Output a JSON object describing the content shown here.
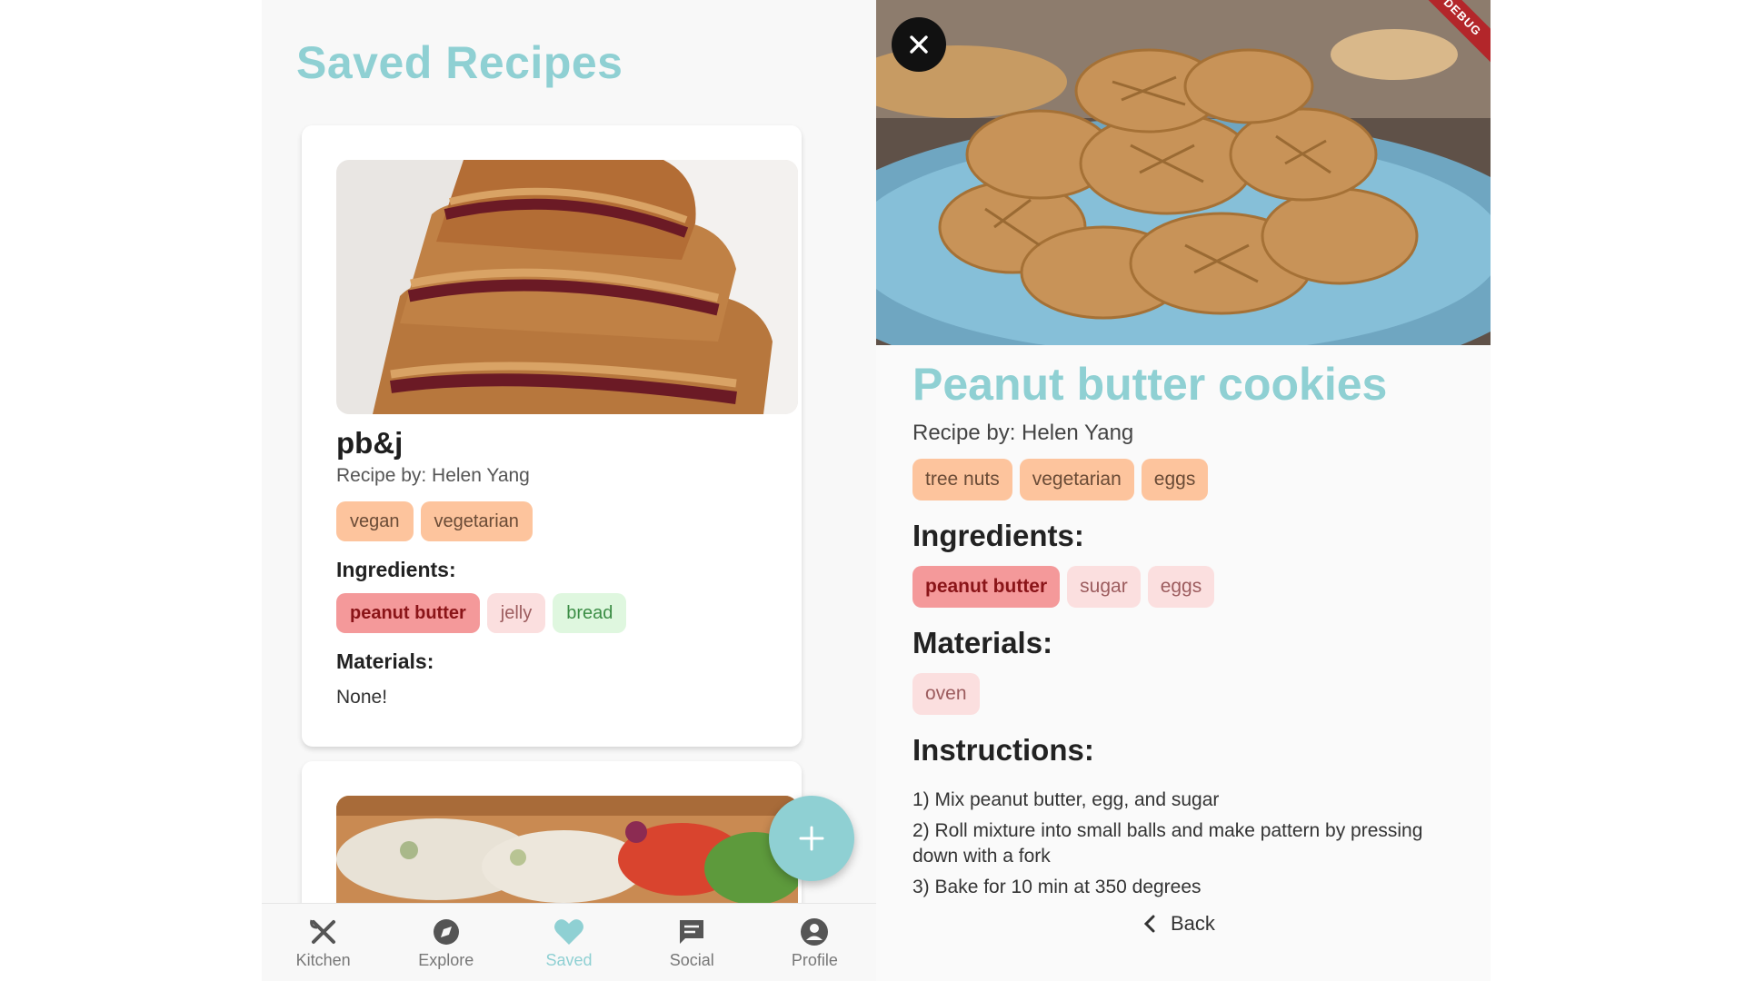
{
  "saved": {
    "title": "Saved Recipes",
    "cards": [
      {
        "name": "pb&j",
        "recipe_by": "Recipe by: Helen Yang",
        "tags": [
          "vegan",
          "vegetarian"
        ],
        "ingredients_label": "Ingredients:",
        "ingredients": [
          "peanut butter",
          "jelly",
          "bread"
        ],
        "materials_label": "Materials:",
        "materials_text": "None!",
        "image": "toasted-pbj-sandwich-photo"
      },
      {
        "image": "chicken-salad-sandwich-photo"
      }
    ],
    "fab_icon": "plus-icon"
  },
  "nav": {
    "items": [
      {
        "label": "Kitchen",
        "icon": "utensils-icon"
      },
      {
        "label": "Explore",
        "icon": "compass-icon"
      },
      {
        "label": "Saved",
        "icon": "heart-icon"
      },
      {
        "label": "Social",
        "icon": "chat-icon"
      },
      {
        "label": "Profile",
        "icon": "profile-icon"
      }
    ],
    "active": "Saved"
  },
  "detail": {
    "image": "peanut-butter-cookies-photo",
    "debug_banner": "DEBUG",
    "title": "Peanut butter cookies",
    "recipe_by": "Recipe by: Helen Yang",
    "tags": [
      "tree nuts",
      "vegetarian",
      "eggs"
    ],
    "ingredients_label": "Ingredients:",
    "ingredients": [
      "peanut butter",
      "sugar",
      "eggs"
    ],
    "materials_label": "Materials:",
    "materials": [
      "oven"
    ],
    "instructions_label": "Instructions:",
    "instructions": [
      "1) Mix peanut butter, egg, and sugar",
      "2) Roll mixture into small balls and make pattern by pressing down with a fork",
      "3) Bake for 10 min at 350 degrees"
    ],
    "back_label": "Back"
  },
  "colors": {
    "accent": "#8fd0d3",
    "diet_chip": "#fdc49d",
    "allergen_chip": "#f4999a",
    "caution_chip": "#fbdfdf",
    "safe_chip": "#dff7df"
  }
}
